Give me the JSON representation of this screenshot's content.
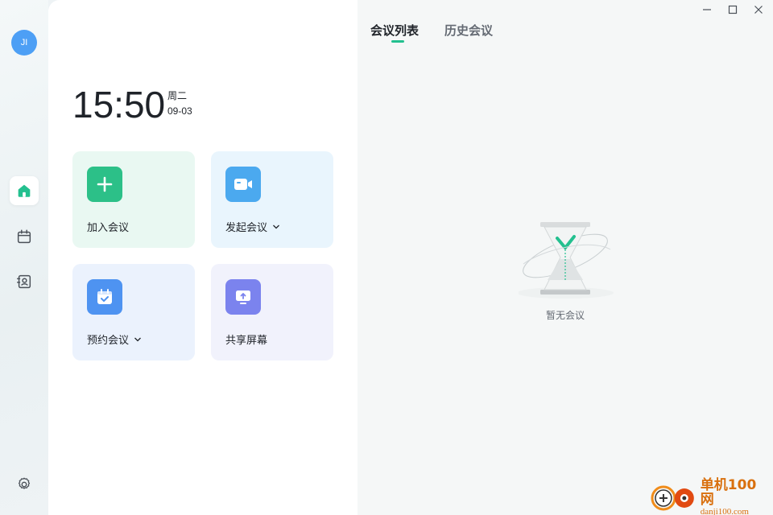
{
  "user": {
    "avatar_initials": "JI"
  },
  "sidebar": {
    "items": [
      {
        "icon": "home-icon",
        "active": true
      },
      {
        "icon": "calendar-icon",
        "active": false
      },
      {
        "icon": "contacts-icon",
        "active": false
      }
    ],
    "settings_icon": "gear-icon"
  },
  "clock": {
    "time": "15:50",
    "weekday": "周二",
    "date": "09-03"
  },
  "actions": {
    "join": {
      "label": "加入会议",
      "icon": "plus-icon",
      "color": "#2cc088"
    },
    "start": {
      "label": "发起会议",
      "icon": "video-camera-icon",
      "color": "#4ba9ef",
      "has_dropdown": true
    },
    "schedule": {
      "label": "预约会议",
      "icon": "calendar-check-icon",
      "color": "#4e93f1",
      "has_dropdown": true
    },
    "share": {
      "label": "共享屏幕",
      "icon": "screen-share-icon",
      "color": "#7b83ee"
    }
  },
  "tabs": [
    {
      "label": "会议列表",
      "active": true
    },
    {
      "label": "历史会议",
      "active": false
    }
  ],
  "accent_color": "#23c08f",
  "empty_state": {
    "text": "暂无会议",
    "icon": "hourglass-icon"
  },
  "window_controls": [
    "minimize-icon",
    "maximize-icon",
    "close-icon"
  ],
  "watermark": {
    "title": "单机100网",
    "url": "danji100.com"
  }
}
